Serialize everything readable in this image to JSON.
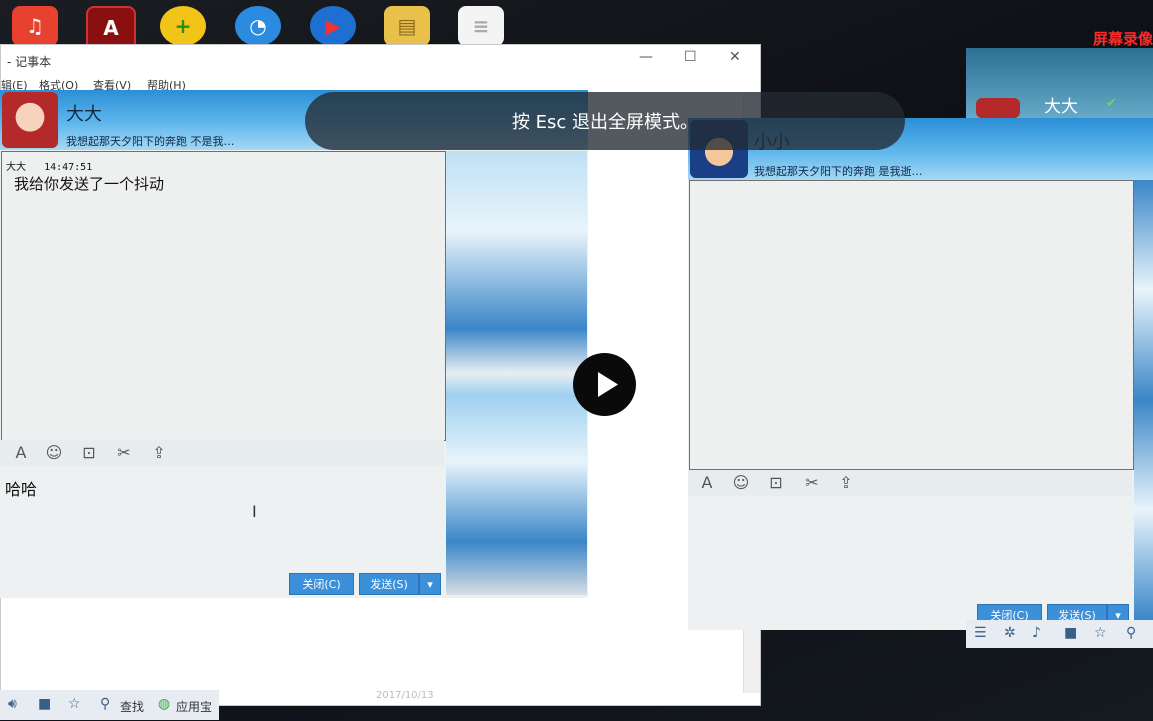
{
  "overlay": {
    "esc_hint": "按 Esc 退出全屏模式。"
  },
  "recorder": {
    "label": "屏幕录像"
  },
  "notepad": {
    "title": "- 记事本",
    "menu": [
      "辑(E)",
      "格式(O)",
      "查看(V)",
      "帮助(H)"
    ],
    "date_fragment": "2017/10/13"
  },
  "chat_left": {
    "nickname": "大大",
    "signature": "我想起那天夕阳下的奔跑 不是我…",
    "messages": [
      {
        "sender": "大大",
        "time": "14:47:51",
        "text": "我给你发送了一个抖动"
      }
    ],
    "input_text": "哈哈",
    "buttons": {
      "close": "关闭(C)",
      "send": "发送(S)"
    }
  },
  "chat_right": {
    "nickname": "小小",
    "signature": "我想起那天夕阳下的奔跑 是我逝…",
    "buttons": {
      "close": "关闭(C)",
      "send": "发送(S)"
    }
  },
  "chat_right_back": {
    "nickname": "大大"
  },
  "bottom_left": {
    "search_label": "查找",
    "appstore_label": "应用宝"
  },
  "icons": [
    "font-icon",
    "emoji-icon",
    "screenshot-icon",
    "scissors-icon",
    "upload-icon",
    "play-icon"
  ],
  "colors": {
    "accent": "#3c8fd9",
    "header_blue": "#2b8fd6",
    "recorder_red": "#ff2a2a"
  }
}
